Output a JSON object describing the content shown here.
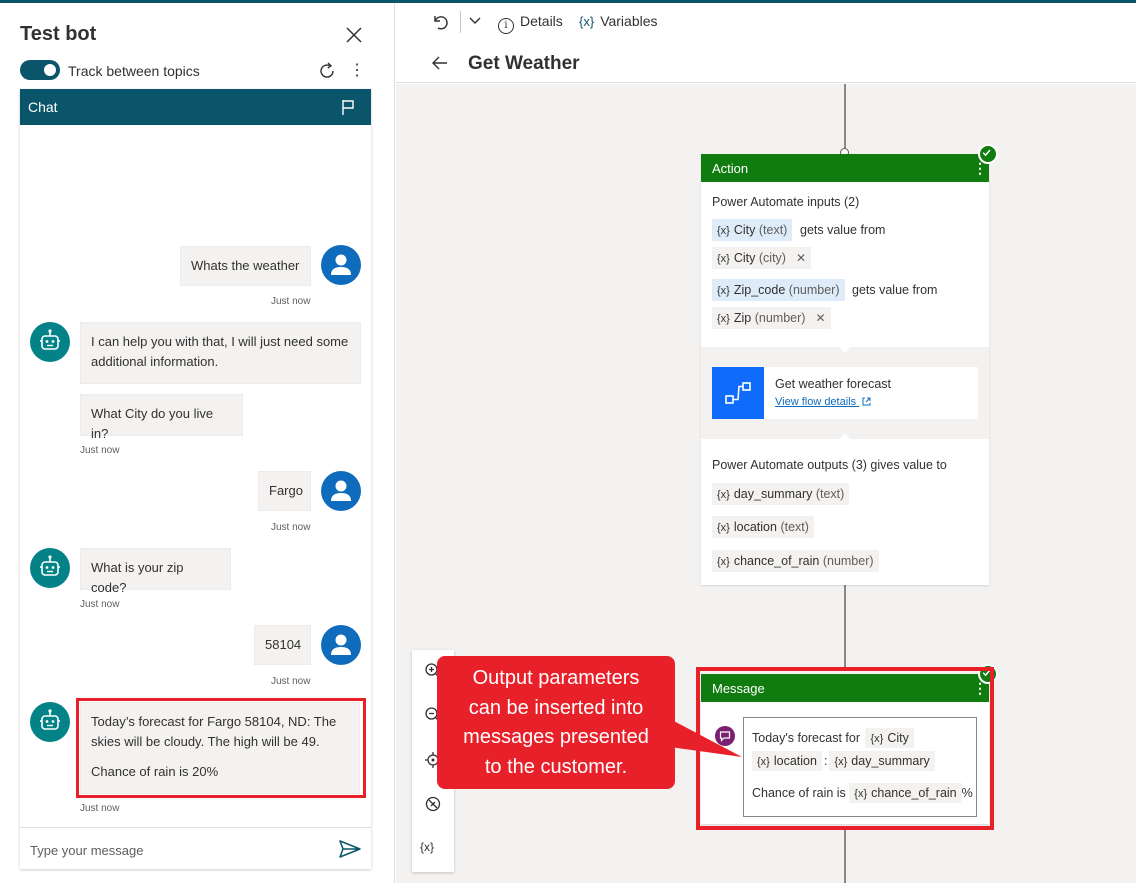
{
  "panel": {
    "title": "Test bot",
    "track_label": "Track between topics",
    "track_on": true,
    "chat_title": "Chat"
  },
  "chat": {
    "messages": [
      {
        "from": "user",
        "text": "Whats the weather",
        "time": "Just now"
      },
      {
        "from": "bot",
        "text": "I can help you with that, I will just need some additional information."
      },
      {
        "from": "bot",
        "text": "What City do you live in?",
        "time": "Just now"
      },
      {
        "from": "user",
        "text": "Fargo",
        "time": "Just now"
      },
      {
        "from": "bot",
        "text": "What is your zip code?",
        "time": "Just now"
      },
      {
        "from": "user",
        "text": "58104",
        "time": "Just now"
      },
      {
        "from": "bot",
        "text": "Today’s forecast for Fargo 58104, ND: The skies will be cloudy. The high will be 49.",
        "text2": "Chance of rain is 20%",
        "time": "Just now"
      }
    ],
    "input_placeholder": "Type your message"
  },
  "toolbar": {
    "details_label": "Details",
    "variables_icon": "{x}",
    "variables_label": "Variables"
  },
  "page": {
    "title": "Get Weather"
  },
  "action_node": {
    "title": "Action",
    "inputs_label": "Power Automate inputs (2)",
    "inputs": [
      {
        "var": "City",
        "type": "(text)",
        "gets": "gets value from",
        "src": "City",
        "src_type": "(city)"
      },
      {
        "var": "Zip_code",
        "type": "(number)",
        "gets": "gets value from",
        "src": "Zip",
        "src_type": "(number)"
      }
    ],
    "flow_name": "Get weather forecast",
    "flow_link": "View flow details",
    "outputs_label": "Power Automate outputs (3) gives value to",
    "outputs": [
      {
        "var": "day_summary",
        "type": "(text)"
      },
      {
        "var": "location",
        "type": "(text)"
      },
      {
        "var": "chance_of_rain",
        "type": "(number)"
      }
    ]
  },
  "message_node": {
    "title": "Message",
    "line1_text": "Today's forecast for",
    "line1_var": "City",
    "line2_var1": "location",
    "line2_sep": ":",
    "line2_var2": "day_summary",
    "line3_text": "Chance of rain is",
    "line3_var": "chance_of_rain",
    "line3_suffix": "%"
  },
  "zoom": {
    "vars_label": "{x}"
  },
  "callout": {
    "text": "Output parameters\ncan be inserted into\nmessages presented\nto the customer."
  },
  "var_icon": "{x}",
  "remove_glyph": "✕",
  "menu_glyph": "⋮",
  "colors": {
    "teal": "#0b556a",
    "node_green": "#107c10",
    "highlight_red": "#e8202a",
    "user_avatar": "#0f6cbd",
    "bot_avatar": "#038387"
  }
}
